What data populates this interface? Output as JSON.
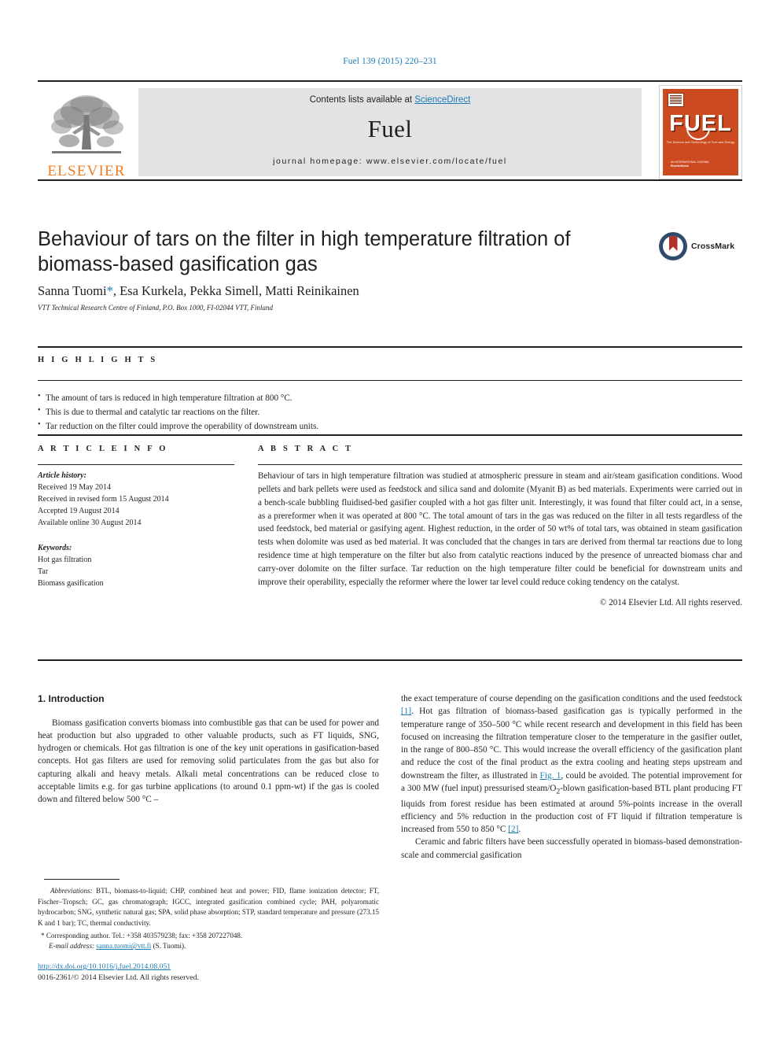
{
  "running_head": "Fuel 139 (2015) 220–231",
  "masthead": {
    "contents_prefix": "Contents lists available at ",
    "sciencedirect": "ScienceDirect",
    "journal_name": "Fuel",
    "homepage": "journal homepage: www.elsevier.com/locate/fuel",
    "publisher_wordmark": "ELSEVIER",
    "cover": {
      "title": "FUEL",
      "subtitle": "The Science and Technology of Fuel and Energy",
      "footer": "AN INTERNATIONAL JOURNAL\nElsevierDirect"
    }
  },
  "article": {
    "title": "Behaviour of tars on the filter in high temperature filtration of biomass-based gasification gas",
    "authors": "Sanna Tuomi, Esa Kurkela, Pekka Simell, Matti Reinikainen",
    "authors_prefix": "Sanna Tuomi",
    "authors_suffix": ", Esa Kurkela, Pekka Simell, Matti Reinikainen",
    "corresponding_marker": "*",
    "affiliation": "VTT Technical Research Centre of Finland, P.O. Box 1000, FI-02044 VTT, Finland",
    "crossmark_label": "CrossMark"
  },
  "highlights": {
    "heading": "H I G H L I G H T S",
    "items": [
      "The amount of tars is reduced in high temperature filtration at 800 °C.",
      "This is due to thermal and catalytic tar reactions on the filter.",
      "Tar reduction on the filter could improve the operability of downstream units."
    ]
  },
  "article_info": {
    "heading": "A R T I C L E   I N F O",
    "history_label": "Article history:",
    "history": [
      "Received 19 May 2014",
      "Received in revised form 15 August 2014",
      "Accepted 19 August 2014",
      "Available online 30 August 2014"
    ],
    "keywords_label": "Keywords:",
    "keywords": [
      "Hot gas filtration",
      "Tar",
      "Biomass gasification"
    ]
  },
  "abstract": {
    "heading": "A B S T R A C T",
    "text": "Behaviour of tars in high temperature filtration was studied at atmospheric pressure in steam and air/steam gasification conditions. Wood pellets and bark pellets were used as feedstock and silica sand and dolomite (Myanit B) as bed materials. Experiments were carried out in a bench-scale bubbling fluidised-bed gasifier coupled with a hot gas filter unit. Interestingly, it was found that filter could act, in a sense, as a prereformer when it was operated at 800 °C. The total amount of tars in the gas was reduced on the filter in all tests regardless of the used feedstock, bed material or gasifying agent. Highest reduction, in the order of 50 wt% of total tars, was obtained in steam gasification tests when dolomite was used as bed material. It was concluded that the changes in tars are derived from thermal tar reactions due to long residence time at high temperature on the filter but also from catalytic reactions induced by the presence of unreacted biomass char and carry-over dolomite on the filter surface. Tar reduction on the high temperature filter could be beneficial for downstream units and improve their operability, especially the reformer where the lower tar level could reduce coking tendency on the catalyst.",
    "copyright": "© 2014 Elsevier Ltd. All rights reserved."
  },
  "body": {
    "section_heading": "1. Introduction",
    "left_paragraph": "Biomass gasification converts biomass into combustible gas that can be used for power and heat production but also upgraded to other valuable products, such as FT liquids, SNG, hydrogen or chemicals. Hot gas filtration is one of the key unit operations in gasification-based concepts. Hot gas filters are used for removing solid particulates from the gas but also for capturing alkali and heavy metals. Alkali metal concentrations can be reduced close to acceptable limits e.g. for gas turbine applications (to around 0.1 ppm-wt) if the gas is cooled down and filtered below 500 °C –",
    "right_paragraph_1_a": "the exact temperature of course depending on the gasification conditions and the used feedstock ",
    "right_ref_1": "[1]",
    "right_paragraph_1_b": ". Hot gas filtration of biomass-based gasification gas is typically performed in the temperature range of 350–500 °C while recent research and development in this field has been focused on increasing the filtration temperature closer to the temperature in the gasifier outlet, in the range of 800–850 °C. This would increase the overall efficiency of the gasification plant and reduce the cost of the final product as the extra cooling and heating steps upstream and downstream the filter, as illustrated in ",
    "right_fig_ref": "Fig. 1",
    "right_paragraph_1_c": ", could be avoided. The potential improvement for a 300 MW (fuel input) pressurised steam/O",
    "right_subscript": "2",
    "right_paragraph_1_d": "-blown gasification-based BTL plant producing FT liquids from forest residue has been estimated at around 5%-points increase in the overall efficiency and 5% reduction in the production cost of FT liquid if filtration temperature is increased from 550 to 850 °C ",
    "right_ref_2": "[2]",
    "right_paragraph_1_e": ".",
    "right_paragraph_2": "Ceramic and fabric filters have been successfully operated in biomass-based demonstration-scale and commercial gasification"
  },
  "footnote": {
    "abbreviations_label": "Abbreviations:",
    "abbreviations_text": " BTL, biomass-to-liquid; CHP, combined heat and power; FID, flame ionization detector; FT, Fischer–Tropsch; GC, gas chromatograph; IGCC, integrated gasification combined cycle; PAH, polyaromatic hydrocarbon; SNG, synthetic natural gas; SPA, solid phase absorption; STP, standard temperature and pressure (273.15 K and 1 bar); TC, thermal conductivity.",
    "corresponding": "* Corresponding author. Tel.: +358 403579238; fax: +358 207227048.",
    "email_label": "E-mail address:",
    "email": "sanna.tuomi@vtt.fi",
    "email_owner": " (S. Tuomi)."
  },
  "footer": {
    "doi_url": "http://dx.doi.org/10.1016/j.fuel.2014.08.051",
    "issn_line": "0016-2361/© 2014 Elsevier Ltd. All rights reserved."
  },
  "colors": {
    "link_blue": "#1a7bb9",
    "elsevier_orange": "#ef7d24",
    "cover_red": "#cc4a1f",
    "crossmark_blue": "#2e4b6e",
    "crossmark_red": "#b4312b"
  }
}
